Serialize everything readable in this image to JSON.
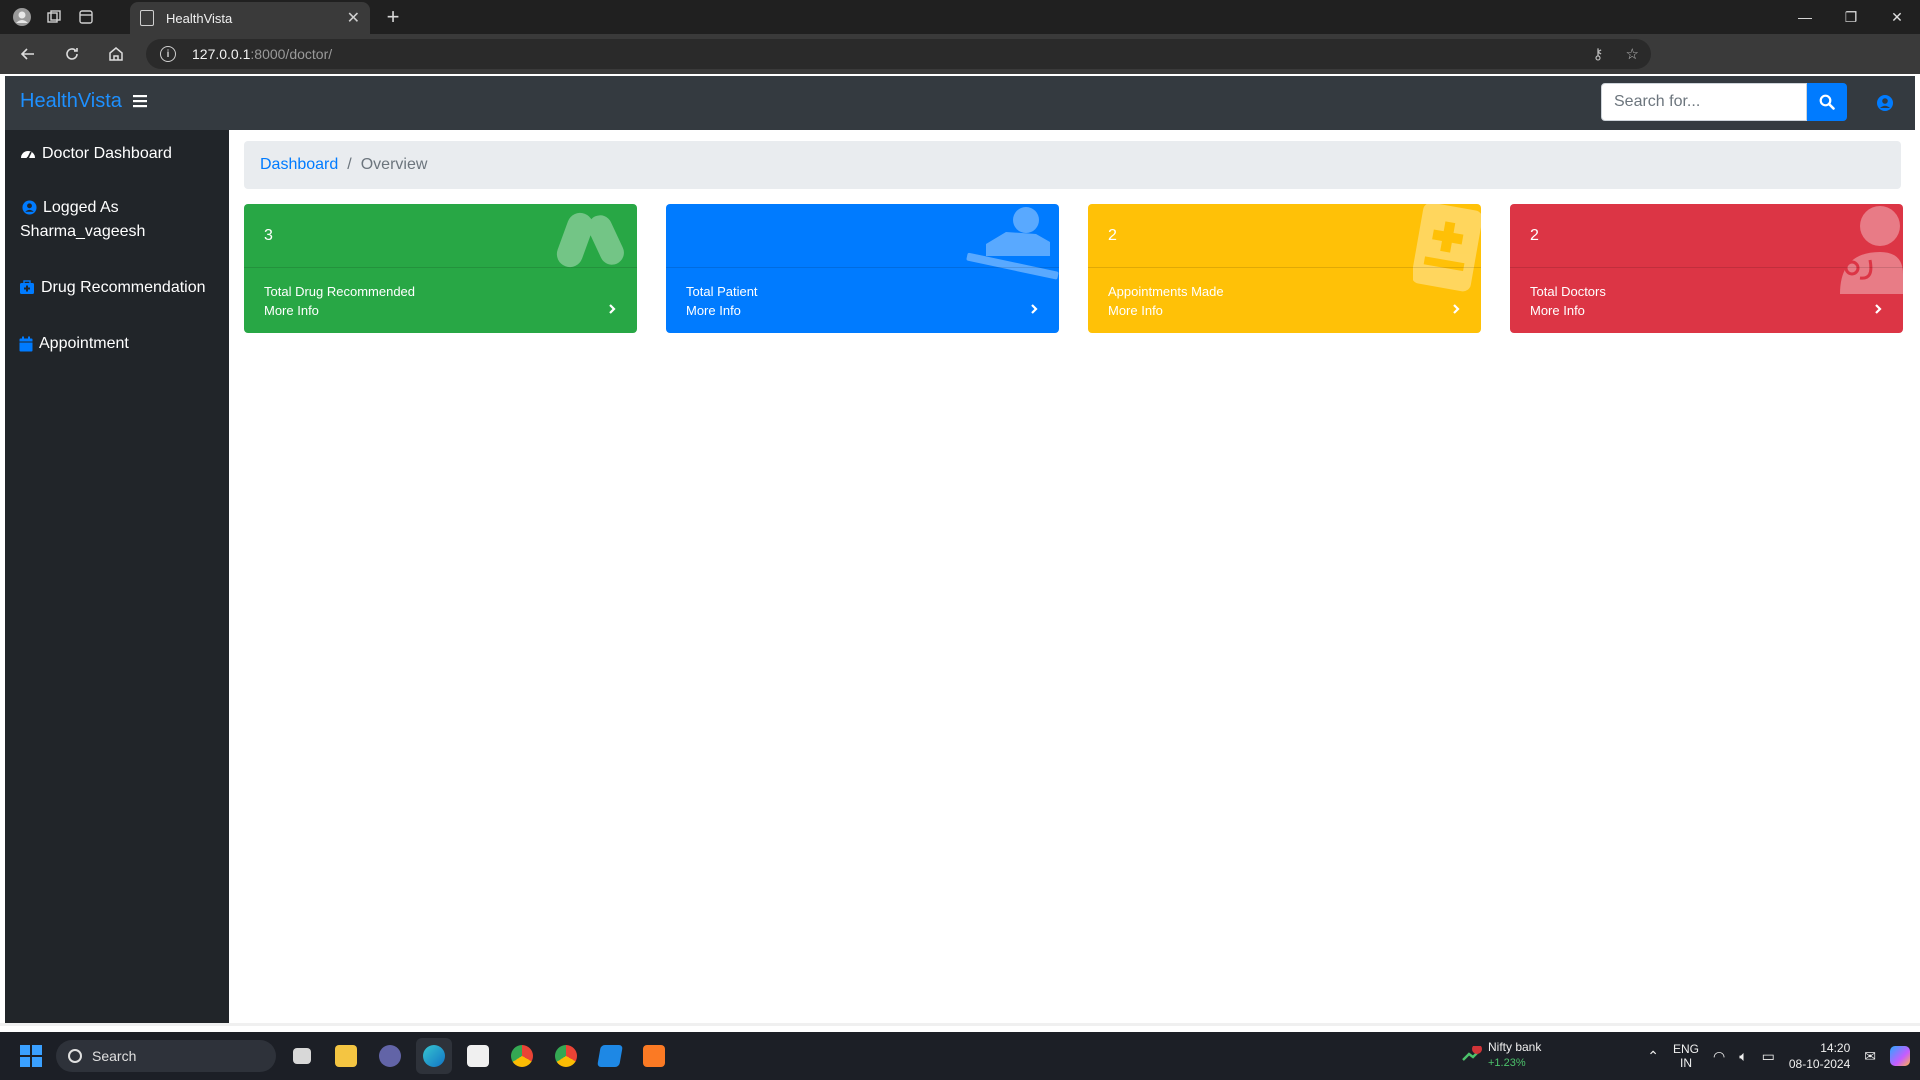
{
  "browser": {
    "tab_title": "HealthVista",
    "url_host": "127.0.0.1",
    "url_rest": ":8000/doctor/"
  },
  "app": {
    "brand": "HealthVista",
    "search": {
      "placeholder": "Search for..."
    },
    "sidebar": {
      "items": [
        {
          "label": "Doctor Dashboard",
          "icon": "tachometer-icon"
        },
        {
          "label": "Logged As",
          "sublabel": "Sharma_vageesh",
          "icon": "user-circle-icon"
        },
        {
          "label": "Drug Recommendation",
          "icon": "medkit-icon"
        },
        {
          "label": "Appointment",
          "icon": "calendar-icon"
        }
      ]
    },
    "breadcrumb": {
      "link": "Dashboard",
      "separator": "/",
      "active": "Overview"
    },
    "cards": [
      {
        "value": "3",
        "title": "Total Drug Recommended",
        "more": "More Info",
        "color": "#28a745",
        "icon": "pills-icon"
      },
      {
        "value": "",
        "title": "Total Patient",
        "more": "More Info",
        "color": "#007bff",
        "icon": "procedures-icon"
      },
      {
        "value": "2",
        "title": "Appointments Made",
        "more": "More Info",
        "color": "#ffc107",
        "icon": "notes-medical-icon"
      },
      {
        "value": "2",
        "title": "Total Doctors",
        "more": "More Info",
        "color": "#dc3545",
        "icon": "user-md-icon"
      }
    ]
  },
  "taskbar": {
    "search_label": "Search",
    "stock": {
      "name": "Nifty bank",
      "change": "+1.23%",
      "badge": "1"
    },
    "lang": {
      "line1": "ENG",
      "line2": "IN"
    },
    "time": "14:20",
    "date": "08-10-2024"
  }
}
